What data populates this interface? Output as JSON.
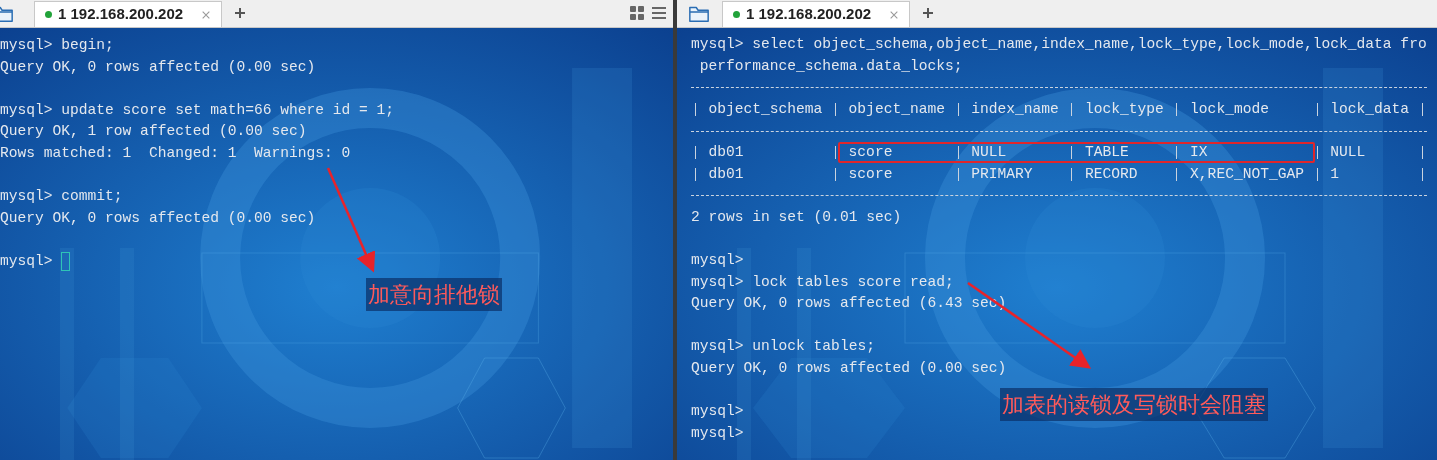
{
  "panes": [
    {
      "tab": {
        "label": "1 192.168.200.202",
        "connected": true,
        "selected": true
      },
      "terminal": [
        {
          "kind": "line",
          "text": "mysql> begin;"
        },
        {
          "kind": "line",
          "text": "Query OK, 0 rows affected (0.00 sec)"
        },
        {
          "kind": "blank"
        },
        {
          "kind": "line",
          "text": "mysql> update score set math=66 where id = 1;"
        },
        {
          "kind": "line",
          "text": "Query OK, 1 row affected (0.00 sec)"
        },
        {
          "kind": "line",
          "text": "Rows matched: 1  Changed: 1  Warnings: 0"
        },
        {
          "kind": "blank"
        },
        {
          "kind": "line",
          "text": "mysql> commit;"
        },
        {
          "kind": "line",
          "text": "Query OK, 0 rows affected (0.00 sec)"
        },
        {
          "kind": "blank"
        },
        {
          "kind": "line",
          "text": "mysql> ",
          "cursor": true
        }
      ],
      "annotation": {
        "text": "加意向排他锁"
      }
    },
    {
      "tab": {
        "label": "1 192.168.200.202",
        "connected": true,
        "selected": true
      },
      "terminal": [
        {
          "kind": "line",
          "text": "mysql> select object_schema,object_name,index_name,lock_type,lock_mode,lock_data fro"
        },
        {
          "kind": "line",
          "text": " performance_schema.data_locks;"
        },
        {
          "kind": "table",
          "columns": [
            "object_schema",
            "object_name",
            "index_name",
            "lock_type",
            "lock_mode",
            "lock_data"
          ],
          "rows": [
            {
              "cells": [
                "db01",
                "score",
                "NULL",
                "TABLE",
                "IX",
                "NULL"
              ],
              "highlighted": true
            },
            {
              "cells": [
                "db01",
                "score",
                "PRIMARY",
                "RECORD",
                "X,REC_NOT_GAP",
                "1"
              ],
              "highlighted": false
            }
          ]
        },
        {
          "kind": "line",
          "text": "2 rows in set (0.01 sec)"
        },
        {
          "kind": "blank"
        },
        {
          "kind": "line",
          "text": "mysql>"
        },
        {
          "kind": "line",
          "text": "mysql> lock tables score read;"
        },
        {
          "kind": "line",
          "text": "Query OK, 0 rows affected (6.43 sec)"
        },
        {
          "kind": "blank"
        },
        {
          "kind": "line",
          "text": "mysql> unlock tables;"
        },
        {
          "kind": "line",
          "text": "Query OK, 0 rows affected (0.00 sec)"
        },
        {
          "kind": "blank"
        },
        {
          "kind": "line",
          "text": "mysql>"
        },
        {
          "kind": "line",
          "text": "mysql>"
        }
      ],
      "annotation": {
        "text": "加表的读锁及写锁时会阻塞"
      }
    }
  ]
}
